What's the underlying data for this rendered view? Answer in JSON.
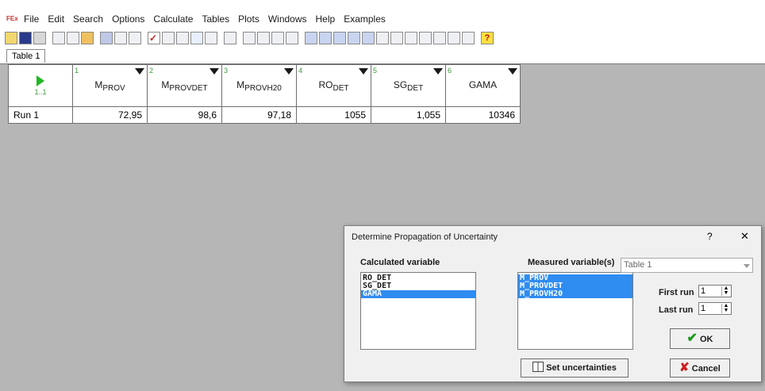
{
  "menu": [
    "File",
    "Edit",
    "Search",
    "Options",
    "Calculate",
    "Tables",
    "Plots",
    "Windows",
    "Help",
    "Examples"
  ],
  "tab": "Table 1",
  "grid": {
    "corner": "1..1",
    "columns": [
      {
        "num": "1",
        "base": "M",
        "sub": "PROV"
      },
      {
        "num": "2",
        "base": "M",
        "sub": "PROVDET"
      },
      {
        "num": "3",
        "base": "M",
        "sub": "PROVH20"
      },
      {
        "num": "4",
        "base": "RO",
        "sub": "DET"
      },
      {
        "num": "5",
        "base": "SG",
        "sub": "DET"
      },
      {
        "num": "6",
        "base": "GAMA",
        "sub": ""
      }
    ],
    "rows": [
      {
        "label": "Run 1",
        "values": [
          "72,95",
          "98,6",
          "97,18",
          "1055",
          "1,055",
          "10346"
        ]
      }
    ]
  },
  "dialog": {
    "title": "Determine Propagation of Uncertainty",
    "help": "?",
    "close": "✕",
    "calc_label": "Calculated variable",
    "calc_items": [
      "RO_DET",
      "SG_DET",
      "GAMA"
    ],
    "meas_label": "Measured variable(s)",
    "meas_items": [
      "M_PROV",
      "M_PROVDET",
      "M_PROVH20"
    ],
    "table_select": "Table 1",
    "first_run_label": "First run",
    "first_run_value": "1",
    "last_run_label": "Last run",
    "last_run_value": "1",
    "ok": "OK",
    "cancel": "Cancel",
    "set_uncert": "Set uncertainties"
  }
}
